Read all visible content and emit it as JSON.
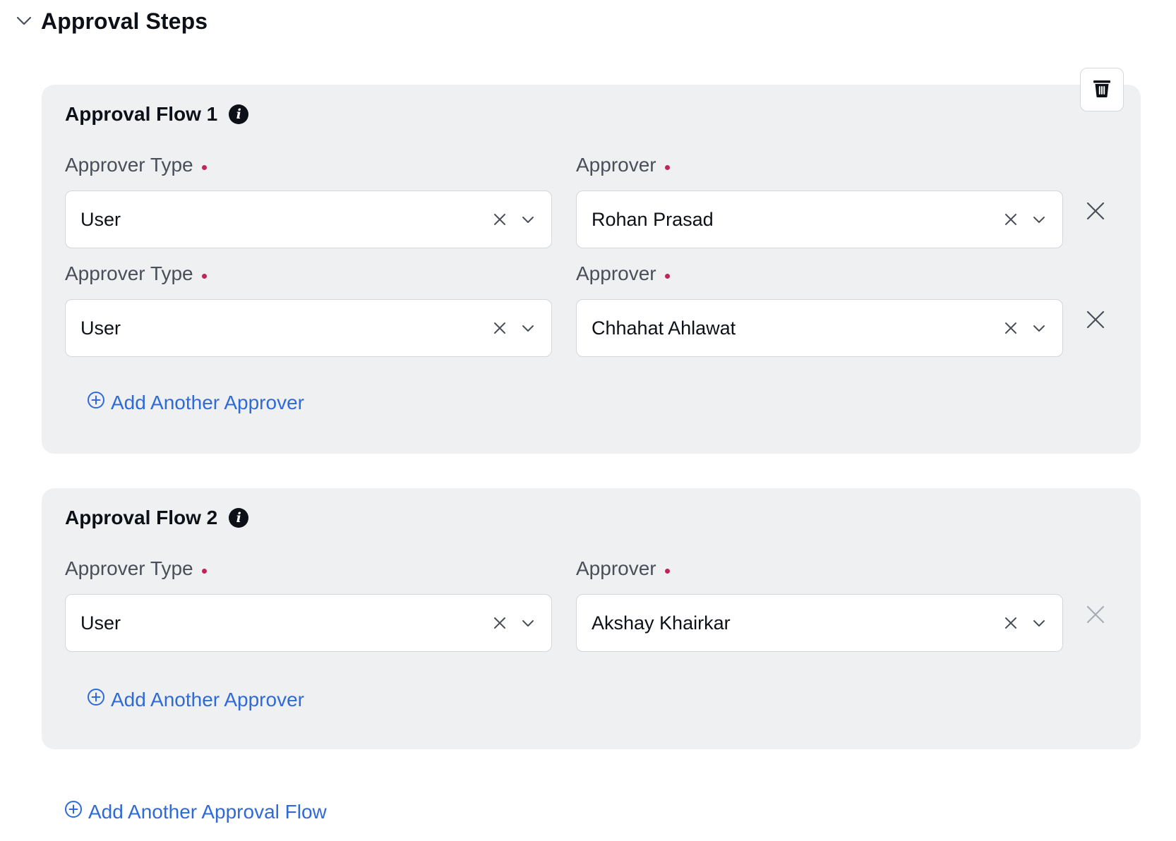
{
  "section": {
    "title": "Approval Steps",
    "expanded": true
  },
  "flows": [
    {
      "title": "Approval Flow 1",
      "rows": [
        {
          "type_label": "Approver Type",
          "type_value": "User",
          "approver_label": "Approver",
          "approver_value": "Rohan Prasad"
        },
        {
          "type_label": "Approver Type",
          "type_value": "User",
          "approver_label": "Approver",
          "approver_value": "Chhahat Ahlawat"
        }
      ],
      "add_approver_label": "Add Another Approver"
    },
    {
      "title": "Approval Flow 2",
      "rows": [
        {
          "type_label": "Approver Type",
          "type_value": "User",
          "approver_label": "Approver",
          "approver_value": "Akshay Khairkar"
        }
      ],
      "add_approver_label": "Add Another Approver"
    }
  ],
  "add_flow_label": "Add Another Approval Flow",
  "colors": {
    "card_bg": "#eff0f2",
    "link": "#2f6ad9",
    "required": "#c0245c"
  },
  "icons": {
    "section_toggle": "chevron-down-icon",
    "delete_flow": "trash-icon",
    "info": "info-icon",
    "clear": "clear-x-icon",
    "dropdown": "chevron-down-icon",
    "remove_row": "close-icon",
    "add": "plus-circle-icon"
  }
}
